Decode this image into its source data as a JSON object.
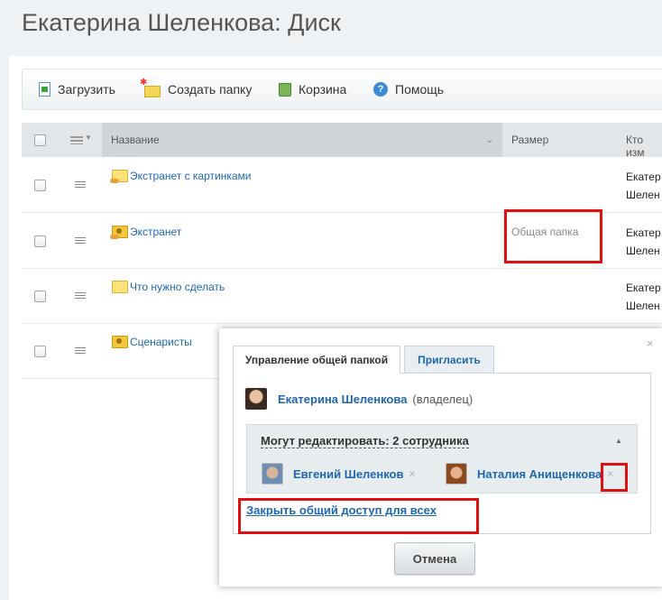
{
  "page": {
    "title": "Екатерина Шеленкова: Диск"
  },
  "toolbar": {
    "upload": "Загрузить",
    "new_folder": "Создать папку",
    "trash": "Корзина",
    "help": "Помощь"
  },
  "table": {
    "columns": {
      "name": "Название",
      "size": "Размер",
      "modified_by": "Кто изм"
    },
    "rows": [
      {
        "name": "Экстранет с картинками",
        "size": "",
        "who_line1": "Екатер",
        "who_line2": "Шелен"
      },
      {
        "name": "Экстранет",
        "size": "Общая папка",
        "who_line1": "Екатер",
        "who_line2": "Шелен"
      },
      {
        "name": "Что нужно сделать",
        "size": "",
        "who_line1": "Екатер",
        "who_line2": "Шелен"
      },
      {
        "name": "Сценаристы",
        "size": "",
        "who_line1": "",
        "who_line2": ""
      }
    ]
  },
  "popup": {
    "close": "×",
    "tabs": [
      "Управление общей папкой",
      "Пригласить"
    ],
    "owner": {
      "name": "Екатерина Шеленкова",
      "role": "(владелец)"
    },
    "editors": {
      "title": "Могут редактировать: 2 сотрудника",
      "collapse": "▲",
      "people": [
        {
          "name": "Евгений Шеленков",
          "remove": "×"
        },
        {
          "name": "Наталия Анищенкова",
          "remove": "×"
        }
      ]
    },
    "close_access": "Закрыть общий доступ для всех",
    "cancel": "Отмена"
  },
  "colors": {
    "link": "#2067b0",
    "highlight": "#e01010"
  }
}
